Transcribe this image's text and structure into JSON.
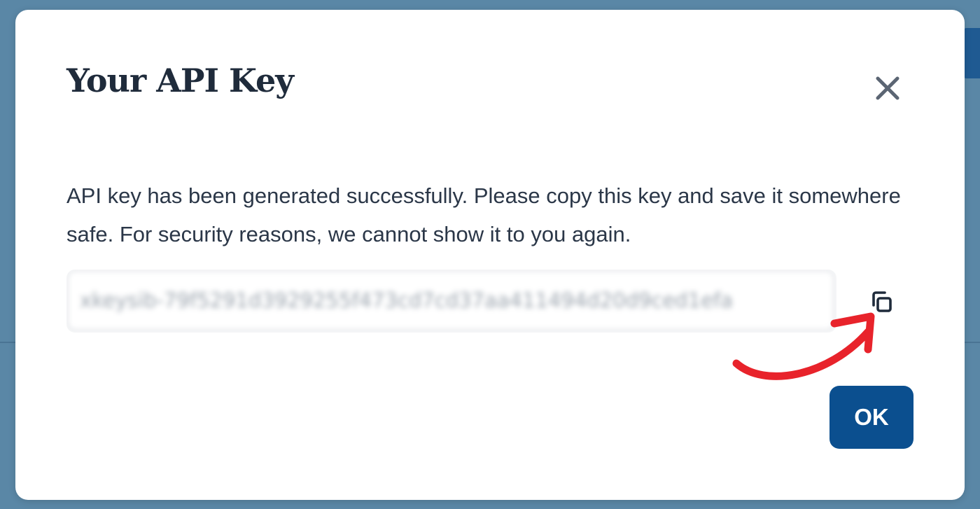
{
  "modal": {
    "title": "Your API Key",
    "message": "API key has been generated successfully. Please copy this key and save it somewhere safe. For security reasons, we cannot show it to you again.",
    "api_key_value": "xkeysib-79f5291d3929255f473cd7cd37aa411494d20d9ced1efa",
    "ok_label": "OK",
    "close_icon": "close-icon",
    "copy_icon": "copy-icon"
  },
  "colors": {
    "primary_button": "#0b4f8f",
    "annotation_arrow": "#e8232b",
    "backdrop": "#4f7e9f"
  }
}
